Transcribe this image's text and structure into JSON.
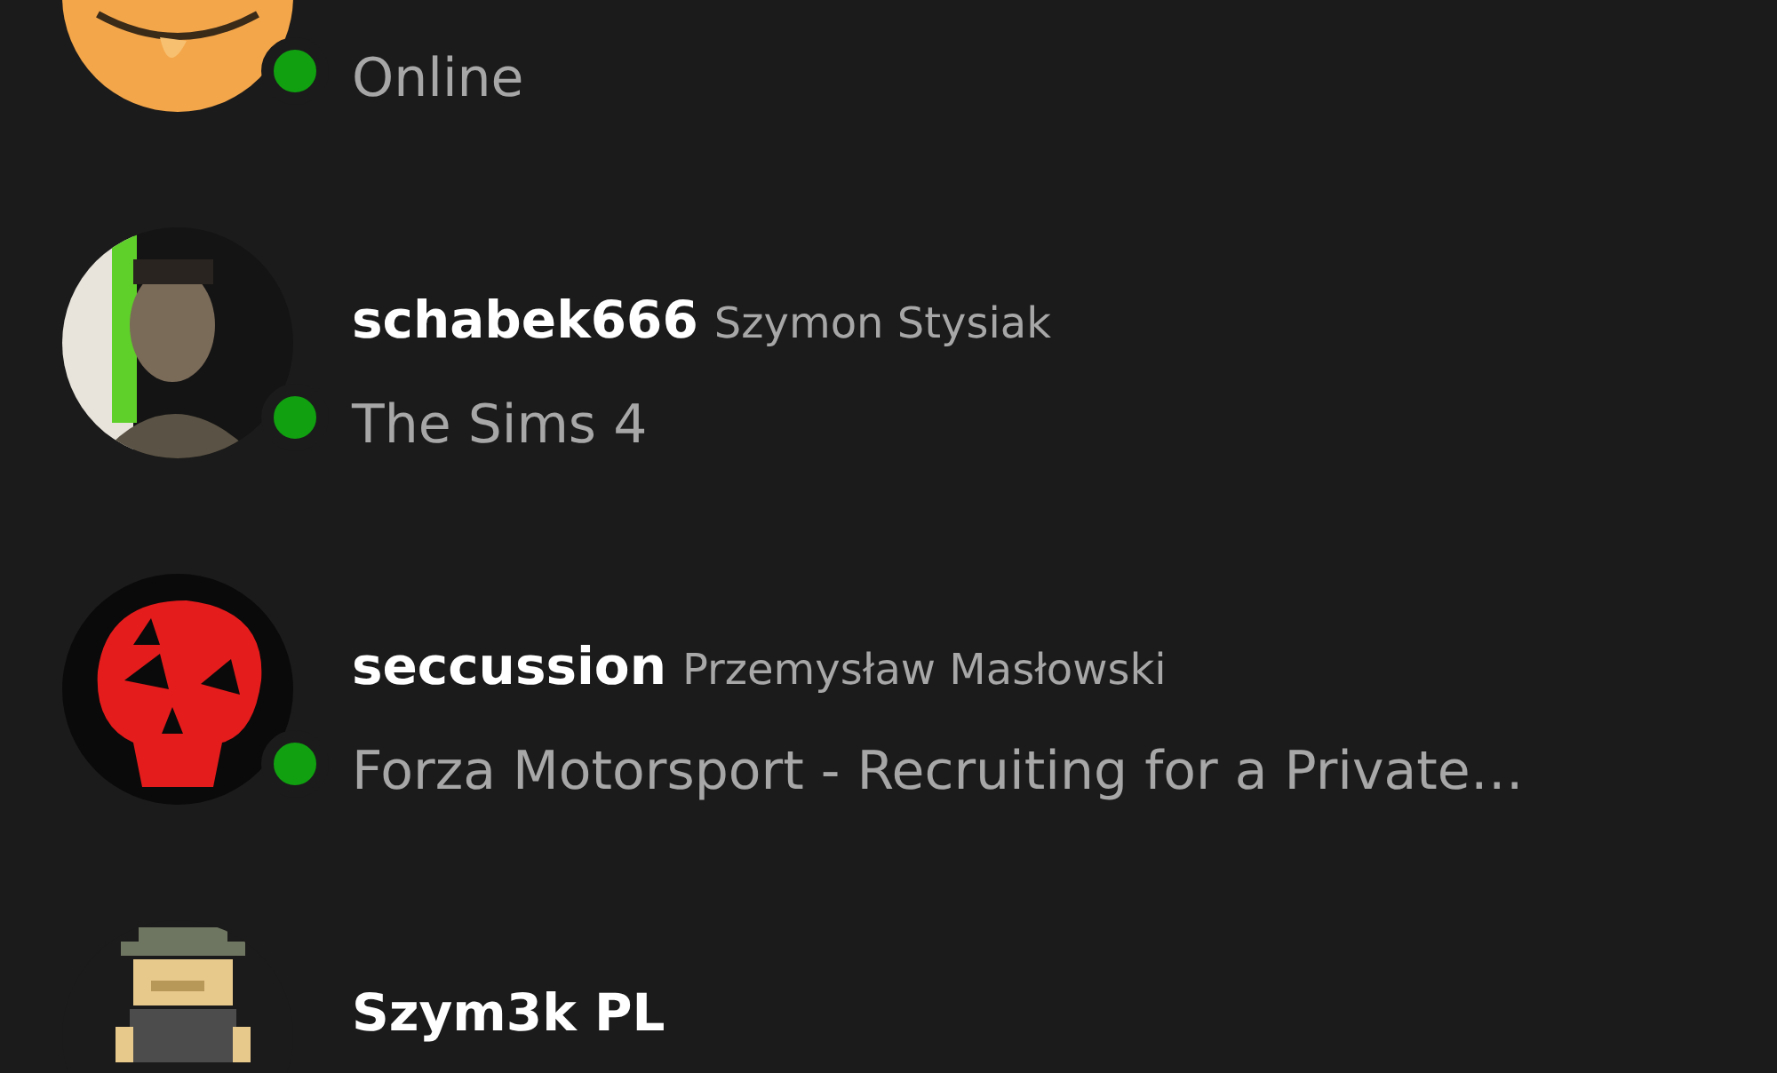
{
  "friends": [
    {
      "status": "Online",
      "online": true
    },
    {
      "gamertag": "schabek666",
      "real_name": "Szymon Stysiak",
      "status": "The Sims 4",
      "online": true
    },
    {
      "gamertag": "seccussion",
      "real_name": "Przemysław Masłowski",
      "status": "Forza Motorsport - Recruiting for a Private…",
      "online": true
    },
    {
      "gamertag": "Szym3k PL"
    }
  ]
}
